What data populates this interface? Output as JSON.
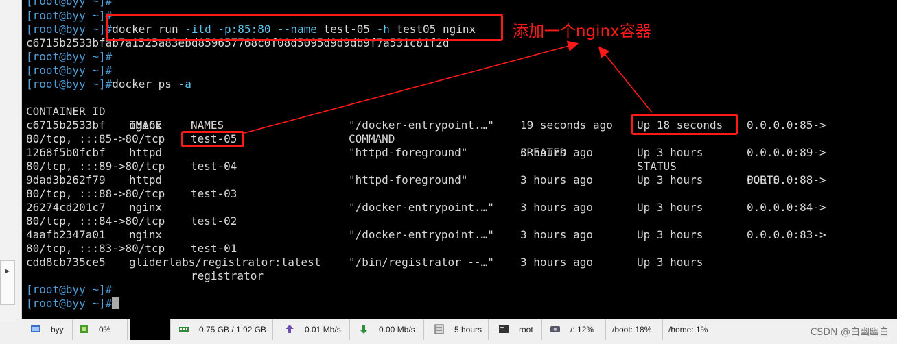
{
  "terminal": {
    "prompt": "[root@byy ~]#",
    "top_partial": "[root@byy ~]#",
    "run_command": "docker run -itd -p:85:80 --name test-05 -h test05 nginx",
    "container_hash": "c6715b2533bfab7a1525a83ebd859657768c0f08d5095d9d9db9f7a531c81f2d",
    "ps_command": "docker ps -a",
    "headers": {
      "container_id": "CONTAINER ID",
      "image": "IMAGE",
      "command": "COMMAND",
      "created": "CREATED",
      "status": "STATUS",
      "ports": "PORTS",
      "names": "NAMES"
    },
    "rows": [
      {
        "id": "c6715b2533bf",
        "image": "nginx",
        "command": "\"/docker-entrypoint.…\"",
        "created": "19 seconds ago",
        "status": "Up 18 seconds",
        "ports": "0.0.0.0:85->",
        "ports2": "80/tcp, :::85->80/tcp",
        "name": "test-05"
      },
      {
        "id": "1268f5b0fcbf",
        "image": "httpd",
        "command": "\"httpd-foreground\"",
        "created": "3 hours ago",
        "status": "Up 3 hours",
        "ports": "0.0.0.0:89->",
        "ports2": "80/tcp, :::89->80/tcp",
        "name": "test-04"
      },
      {
        "id": "9dad3b262f79",
        "image": "httpd",
        "command": "\"httpd-foreground\"",
        "created": "3 hours ago",
        "status": "Up 3 hours",
        "ports": "0.0.0.0:88->",
        "ports2": "80/tcp, :::88->80/tcp",
        "name": "test-03"
      },
      {
        "id": "26274cd201c7",
        "image": "nginx",
        "command": "\"/docker-entrypoint.…\"",
        "created": "3 hours ago",
        "status": "Up 3 hours",
        "ports": "0.0.0.0:84->",
        "ports2": "80/tcp, :::84->80/tcp",
        "name": "test-02"
      },
      {
        "id": "4aafb2347a01",
        "image": "nginx",
        "command": "\"/docker-entrypoint.…\"",
        "created": "3 hours ago",
        "status": "Up 3 hours",
        "ports": "0.0.0.0:83->",
        "ports2": "80/tcp, :::83->80/tcp",
        "name": "test-01"
      },
      {
        "id": "cdd8cb735ce5",
        "image": "gliderlabs/registrator:latest",
        "command": "\"/bin/registrator --…\"",
        "created": "3 hours ago",
        "status": "Up 3 hours",
        "ports": "",
        "ports2": "",
        "name": "registrator"
      }
    ]
  },
  "annotation": {
    "text": "添加一个nginx容器",
    "color": "#ff1a1a"
  },
  "status_bar": {
    "host": "byy",
    "cpu": "0%",
    "memory": "0.75 GB / 1.92 GB",
    "upload": "0.01 Mb/s",
    "download": "0.00 Mb/s",
    "uptime": "5 hours",
    "user": "root",
    "disk_root": "/: 12%",
    "disk_boot": "/boot: 18%",
    "disk_home": "/home: 1%",
    "watermark": "CSDN @白幽幽白"
  },
  "colors": {
    "terminal_bg": "#000000",
    "prompt": "#4f9fd8",
    "flag": "#5cc5ea",
    "text": "#d8d8d8"
  }
}
